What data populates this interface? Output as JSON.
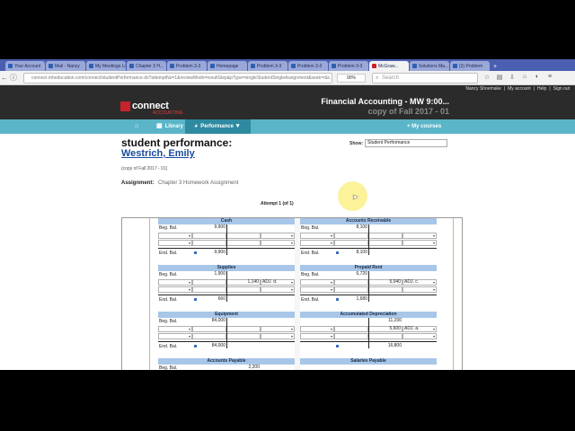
{
  "browser": {
    "tabs": [
      {
        "label": "Your Account",
        "active": false
      },
      {
        "label": "Mail - Nancy",
        "active": false
      },
      {
        "label": "My Meetings List",
        "active": false
      },
      {
        "label": "Chapter 3 H...",
        "active": false
      },
      {
        "label": "Problem 3-3",
        "active": false
      },
      {
        "label": "Homepage",
        "active": false
      },
      {
        "label": "Problem 3-3",
        "active": false
      },
      {
        "label": "Problem 3-3",
        "active": false
      },
      {
        "label": "Problem 3-3",
        "active": false
      },
      {
        "label": "McGraw...",
        "active": true
      },
      {
        "label": "Solutions Ma...",
        "active": false
      },
      {
        "label": "(2) Problem",
        "active": false
      }
    ],
    "url": "connect.mheducation.com/connect/studentPerformance.do?attemptNo=1&reviewMode=resultStep&pType=singleStudentSingleAssignment&seek=r&c...",
    "zoom": "90%",
    "search_placeholder": "Search"
  },
  "connect": {
    "user_links": [
      "Nancy Shoemake",
      "|",
      "My account",
      "|",
      "Help",
      "|",
      "Sign out"
    ],
    "brand": "connect",
    "brand_sub": "ACCOUNTING",
    "course_title": "Financial Accounting - MW 9:00...",
    "course_subtitle": "copy of Fall 2017 - 01",
    "nav": {
      "library": "Library",
      "performance": "Performance",
      "my_courses": "+ My courses"
    }
  },
  "page": {
    "title": "student performance:",
    "student_name": "Westrich, Emily",
    "copy_note": "(copy of Fall 2017 - 01)",
    "show_label": "Show:",
    "show_value": "Student Performance",
    "assignment_label": "Assignment:",
    "assignment_value": "Chapter 3 Homework Assignment",
    "attempt": "Attempt 1 (of 1)"
  },
  "accounts": [
    {
      "name": "Cash",
      "beg_label": "Beg. Bal.",
      "beg_value": "9,900",
      "row2_credit": "",
      "row2_tag": "",
      "end_label": "End. Bal.",
      "end_value": "9,900"
    },
    {
      "name": "Accounts Receivable",
      "beg_label": "Beg. Bal.",
      "beg_value": "8,100",
      "row2_credit": "",
      "row2_tag": "",
      "end_label": "End. Bal.",
      "end_value": "8,100"
    },
    {
      "name": "Supplies",
      "beg_label": "Beg. Bal.",
      "beg_value": "1,900",
      "row2_credit": "1,140",
      "row2_tag": "ADJ. d.",
      "end_label": "End. Bal.",
      "end_value": "660"
    },
    {
      "name": "Prepaid Rent",
      "beg_label": "Beg. Bal.",
      "beg_value": "6,720",
      "row2_credit": "5,040",
      "row2_tag": "ADJ. c.",
      "end_label": "End. Bal.",
      "end_value": "1,680"
    },
    {
      "name": "Equipment",
      "beg_label": "Beg. Bal.",
      "beg_value": "84,000",
      "row2_credit": "",
      "row2_tag": "",
      "end_label": "End. Bal.",
      "end_value": "84,000"
    },
    {
      "name": "Accumulated Depreciation",
      "beg_label": "",
      "beg_value": "",
      "beg_credit": "11,200",
      "row2_credit": "5,600",
      "row2_tag": "ADJ. a.",
      "end_label": "",
      "end_value": "",
      "end_credit": "16,800"
    },
    {
      "name": "Accounts Payable",
      "beg_label": "Beg. Bal.",
      "beg_value": "",
      "beg_credit": "2,200"
    },
    {
      "name": "Salaries Payable",
      "beg_label": "",
      "beg_value": ""
    }
  ]
}
